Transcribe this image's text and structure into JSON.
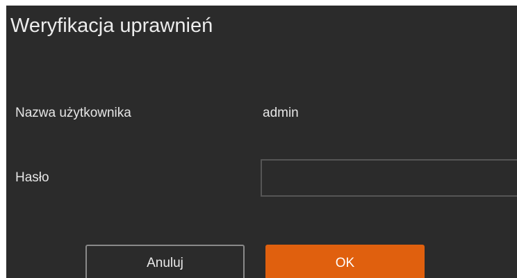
{
  "dialog": {
    "title": "Weryfikacja uprawnień",
    "username_label": "Nazwa użytkownika",
    "username_value": "admin",
    "password_label": "Hasło",
    "password_value": "",
    "cancel_label": "Anuluj",
    "ok_label": "OK"
  },
  "colors": {
    "dialog_background": "#2b2b2b",
    "accent": "#e0600e"
  }
}
